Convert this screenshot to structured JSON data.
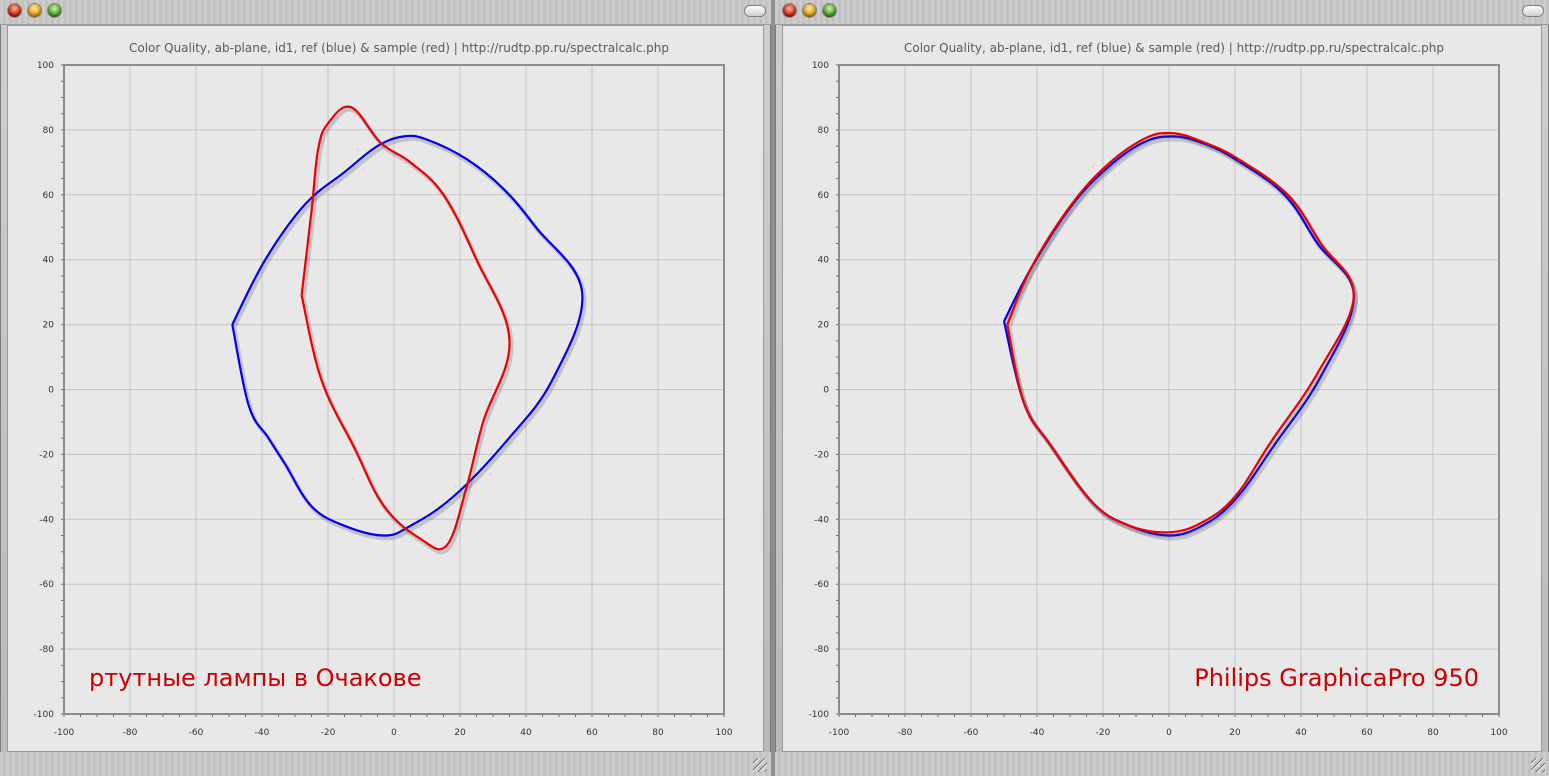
{
  "windows": [
    {
      "title": "Color Quality, ab-plane, id1, ref (blue) & sample (red) | http://rudtp.pp.ru/spectralcalc.php",
      "annotation": "ртутные лампы в Очакове",
      "annotation_pos": "bottom-left",
      "chart_data": {
        "type": "line",
        "title": "Color Quality, ab-plane, id1, ref (blue) & sample (red) | http://rudtp.pp.ru/spectralcalc.php",
        "xlabel": "",
        "ylabel": "",
        "xlim": [
          -100,
          100
        ],
        "ylim": [
          -100,
          100
        ],
        "ticks": [
          -100,
          -80,
          -60,
          -40,
          -20,
          0,
          20,
          40,
          60,
          80,
          100
        ],
        "grid": true,
        "series": [
          {
            "color": "#0000ee",
            "points": [
              [
                -49,
                20
              ],
              [
                -44,
                -5
              ],
              [
                -38,
                -15
              ],
              [
                -33,
                -23
              ],
              [
                -25,
                -36
              ],
              [
                -15,
                -42
              ],
              [
                -3,
                -45
              ],
              [
                5,
                -42
              ],
              [
                18,
                -33
              ],
              [
                34,
                -16
              ],
              [
                48,
                3
              ],
              [
                57,
                30
              ],
              [
                43,
                50
              ],
              [
                33,
                62
              ],
              [
                22,
                71
              ],
              [
                10,
                77
              ],
              [
                3,
                78
              ],
              [
                -5,
                75
              ],
              [
                -15,
                67
              ],
              [
                -27,
                57
              ],
              [
                -39,
                40
              ],
              [
                -49,
                20
              ]
            ]
          },
          {
            "color": "#ee0000",
            "points": [
              [
                -28,
                29
              ],
              [
                -22,
                3
              ],
              [
                -12,
                -18
              ],
              [
                -3,
                -36
              ],
              [
                8,
                -46
              ],
              [
                16,
                -48
              ],
              [
                22,
                -30
              ],
              [
                27,
                -10
              ],
              [
                35,
                15
              ],
              [
                25,
                40
              ],
              [
                15,
                60
              ],
              [
                5,
                70
              ],
              [
                -4,
                76
              ],
              [
                -13,
                87
              ],
              [
                -20,
                82
              ],
              [
                -23,
                74
              ],
              [
                -25,
                55
              ],
              [
                -28,
                29
              ]
            ]
          }
        ]
      }
    },
    {
      "title": "Color Quality, ab-plane, id1, ref (blue) & sample (red) | http://rudtp.pp.ru/spectralcalc.php",
      "annotation": "Philips GraphicaPro 950",
      "annotation_pos": "bottom-right",
      "chart_data": {
        "type": "line",
        "title": "Color Quality, ab-plane, id1, ref (blue) & sample (red) | http://rudtp.pp.ru/spectralcalc.php",
        "xlabel": "",
        "ylabel": "",
        "xlim": [
          -100,
          100
        ],
        "ylim": [
          -100,
          100
        ],
        "ticks": [
          -100,
          -80,
          -60,
          -40,
          -20,
          0,
          20,
          40,
          60,
          80,
          100
        ],
        "grid": true,
        "series": [
          {
            "color": "#0000ee",
            "points": [
              [
                -50,
                21
              ],
              [
                -44,
                -4
              ],
              [
                -36,
                -17
              ],
              [
                -23,
                -35
              ],
              [
                -12,
                -42
              ],
              [
                0,
                -45
              ],
              [
                10,
                -42
              ],
              [
                20,
                -34
              ],
              [
                32,
                -17
              ],
              [
                46,
                4
              ],
              [
                56,
                29
              ],
              [
                45,
                45
              ],
              [
                35,
                60
              ],
              [
                20,
                71
              ],
              [
                10,
                76
              ],
              [
                1,
                78
              ],
              [
                -8,
                76
              ],
              [
                -19,
                68
              ],
              [
                -30,
                56
              ],
              [
                -42,
                37
              ],
              [
                -50,
                21
              ]
            ]
          },
          {
            "color": "#ee0000",
            "points": [
              [
                -49,
                20
              ],
              [
                -44,
                -4
              ],
              [
                -36,
                -17
              ],
              [
                -23,
                -35
              ],
              [
                -12,
                -42
              ],
              [
                0,
                -44
              ],
              [
                10,
                -41
              ],
              [
                20,
                -33
              ],
              [
                31,
                -16
              ],
              [
                45,
                5
              ],
              [
                56,
                29
              ],
              [
                46,
                45
              ],
              [
                36,
                60
              ],
              [
                21,
                71
              ],
              [
                11,
                76
              ],
              [
                1,
                79
              ],
              [
                -8,
                77
              ],
              [
                -20,
                68
              ],
              [
                -31,
                55
              ],
              [
                -42,
                37
              ],
              [
                -49,
                20
              ]
            ]
          }
        ]
      }
    }
  ]
}
